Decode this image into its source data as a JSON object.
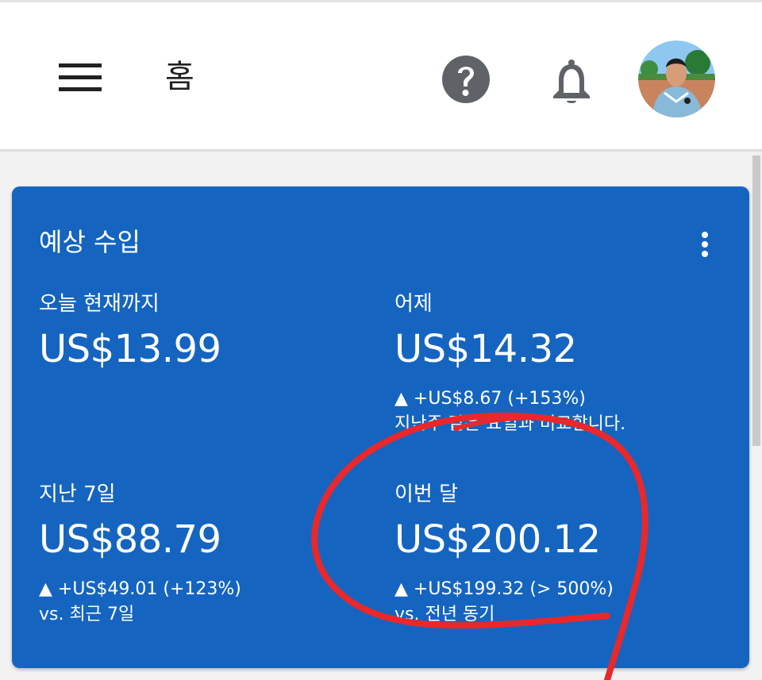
{
  "header": {
    "title": "홈",
    "menu_icon": "hamburger-menu-icon",
    "help_icon": "help-circle-icon",
    "notification_icon": "bell-icon",
    "avatar": "user-avatar"
  },
  "earnings_card": {
    "title": "예상 수입",
    "menu_icon": "more-vertical-icon",
    "accent_color": "#1565c0",
    "metrics": {
      "today": {
        "label": "오늘 현재까지",
        "value": "US$13.99"
      },
      "yesterday": {
        "label": "어제",
        "value": "US$14.32",
        "change": "▲ +US$8.67 (+153%)",
        "comparison": "지난주 같은 요일과 비교합니다."
      },
      "last_7_days": {
        "label": "지난 7일",
        "value": "US$88.79",
        "change": "▲ +US$49.01 (+123%)",
        "comparison": "vs. 최근 7일"
      },
      "this_month": {
        "label": "이번 달",
        "value": "US$200.12",
        "change": "▲ +US$199.32 (> 500%)",
        "comparison": "vs. 전년 동기"
      }
    }
  },
  "annotation": {
    "color": "#e8282b",
    "shape": "hand-drawn circle around this month earnings"
  }
}
